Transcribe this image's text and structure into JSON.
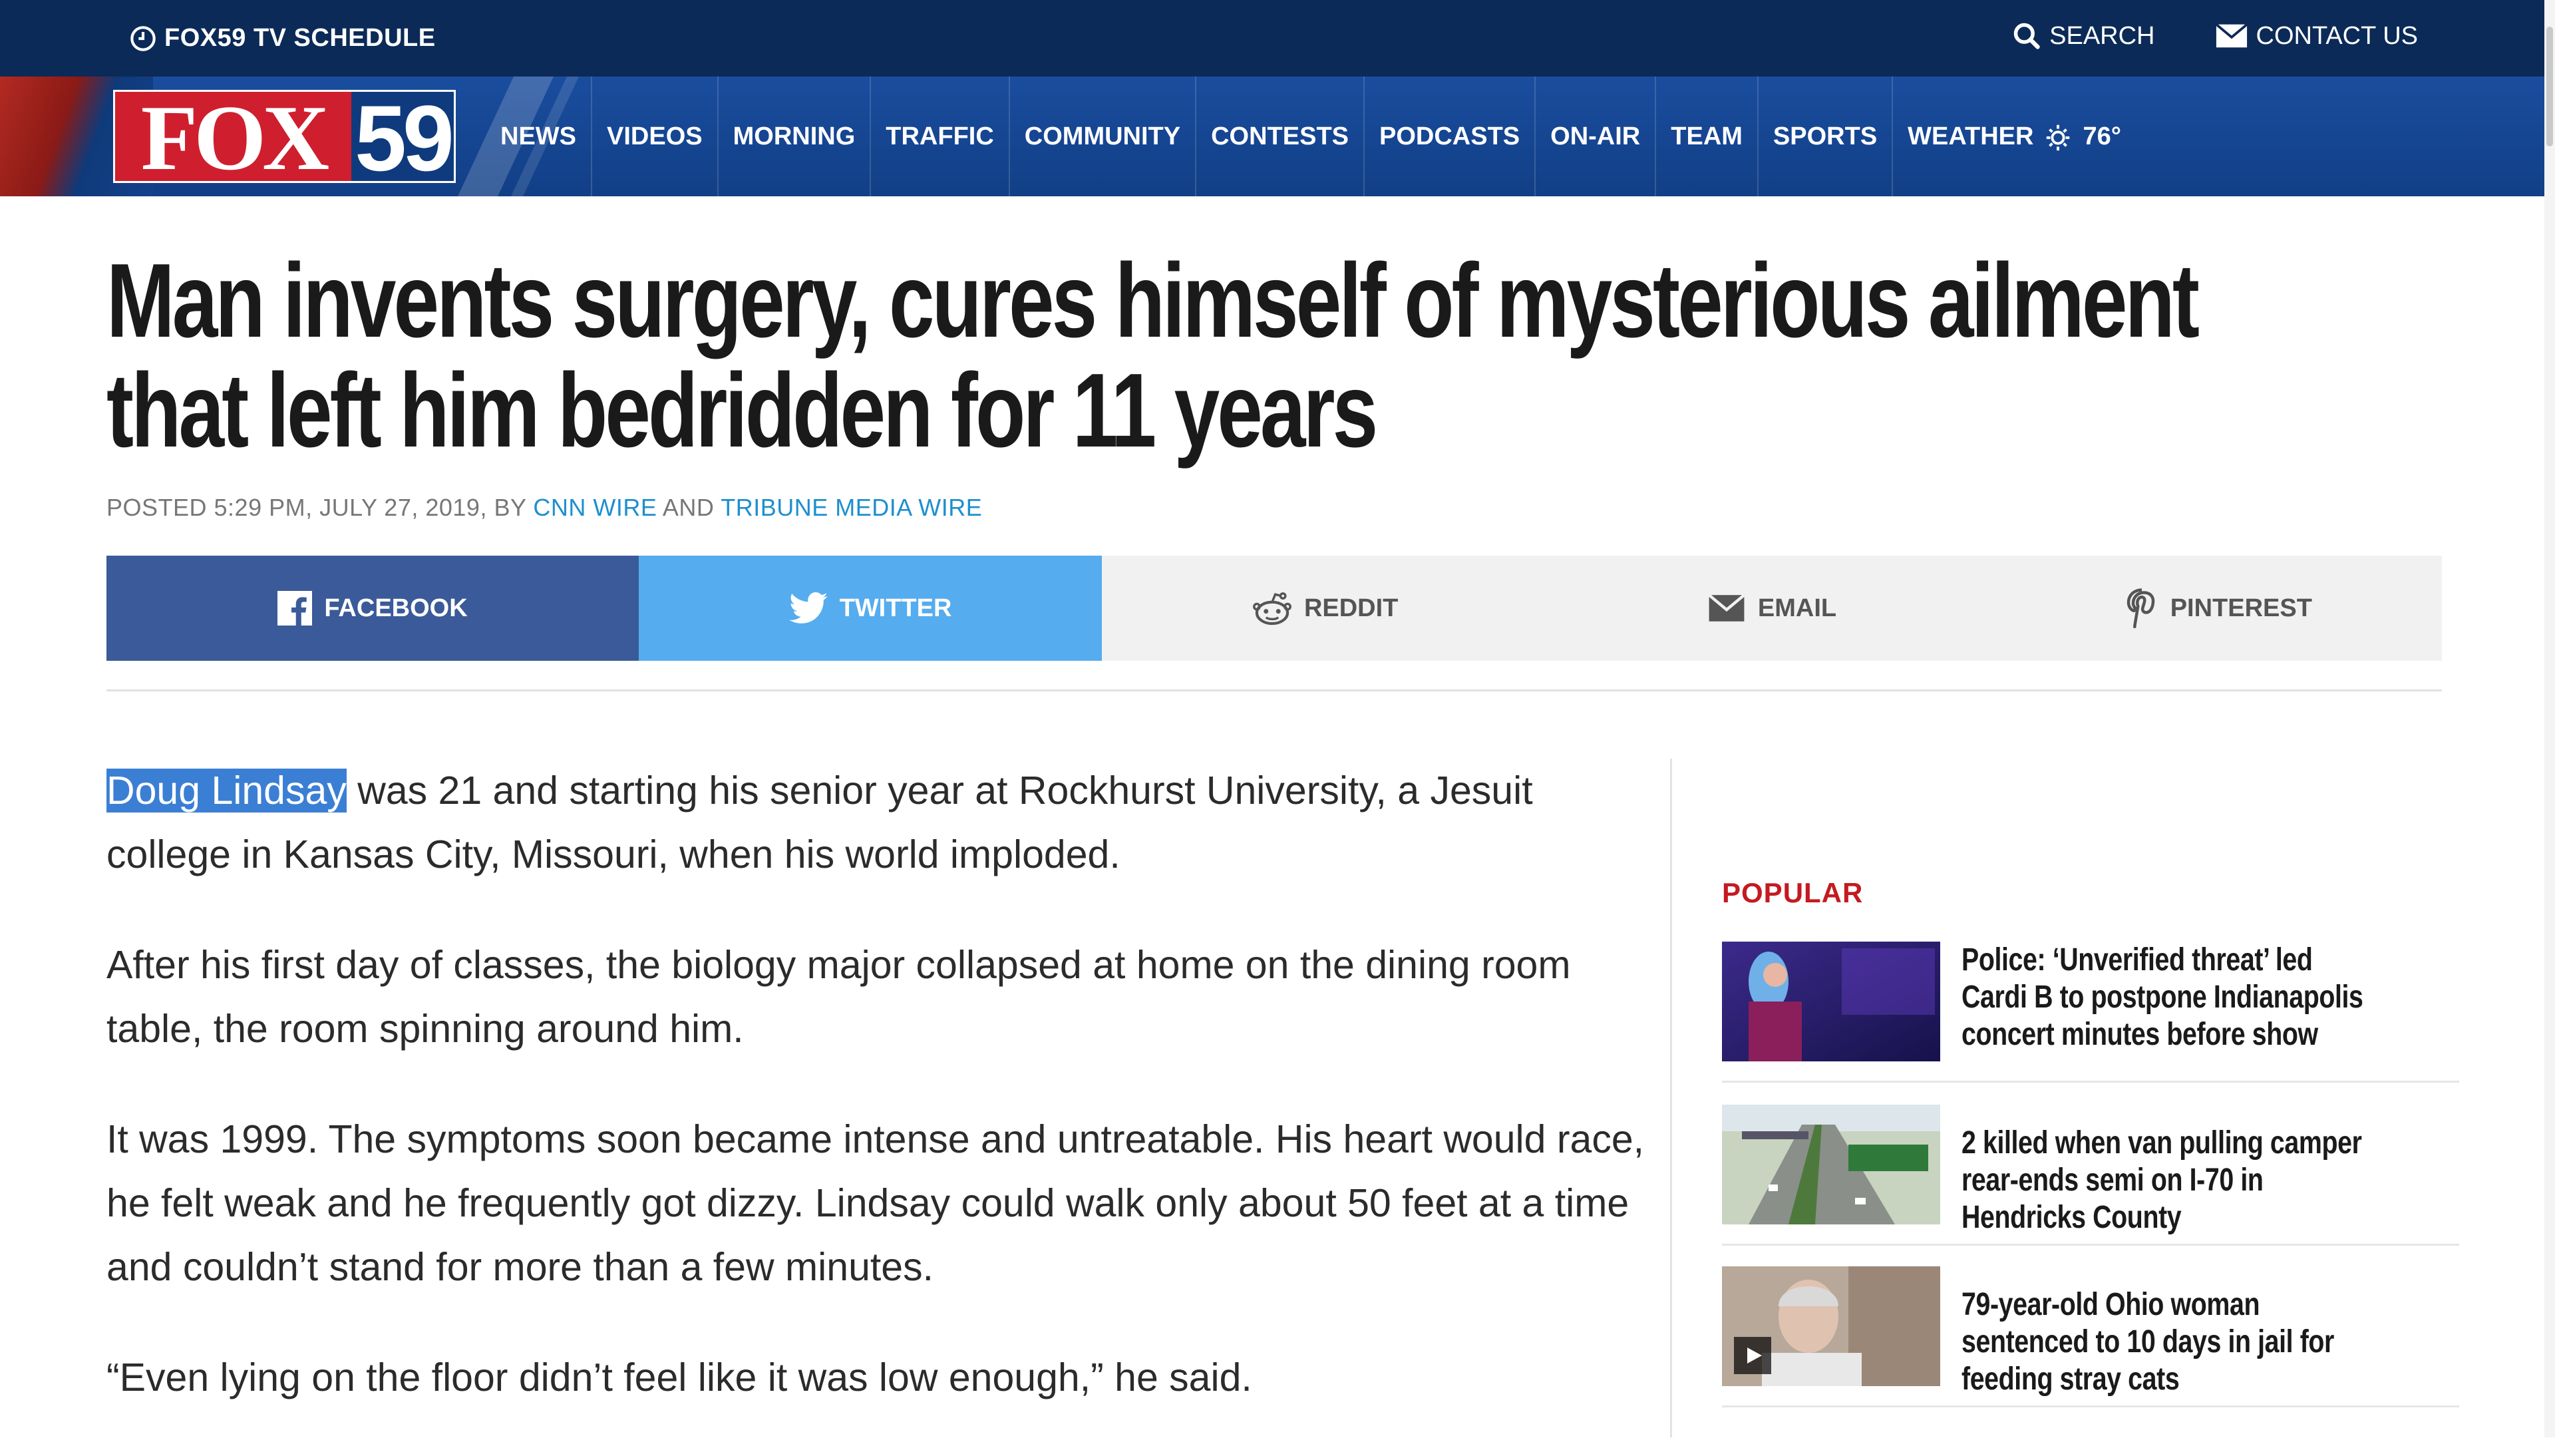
{
  "topbar": {
    "schedule": "FOX59 TV SCHEDULE",
    "search": "SEARCH",
    "contact": "CONTACT US"
  },
  "logo": {
    "fox": "FOX",
    "num": "59"
  },
  "nav": {
    "items": [
      "NEWS",
      "VIDEOS",
      "MORNING",
      "TRAFFIC",
      "COMMUNITY",
      "CONTESTS",
      "PODCASTS",
      "ON-AIR",
      "TEAM",
      "SPORTS"
    ],
    "weather": "WEATHER",
    "temp": "76°"
  },
  "article": {
    "headline": "Man invents surgery, cures himself of mysterious ailment that left him bedridden for 11 years",
    "byline_prefix": "POSTED 5:29 PM, JULY 27, 2019, BY",
    "author1": "CNN WIRE",
    "byline_and": "AND",
    "author2": "TRIBUNE MEDIA WIRE",
    "highlight": "Doug Lindsay",
    "p1_rest": " was 21 and starting his senior year at Rockhurst University, a Jesuit college in Kansas City, Missouri, when his world imploded.",
    "p2": "After his first day of classes, the biology major collapsed at home on the dining room table, the room spinning around him.",
    "p3": "It was 1999. The symptoms soon became intense and untreatable. His heart would race, he felt weak and he frequently got dizzy. Lindsay could walk only about 50 feet at a time and couldn’t stand for more than a few minutes.",
    "p4": "“Even lying on the floor didn’t feel like it was low enough,” he said."
  },
  "share": {
    "facebook": "FACEBOOK",
    "twitter": "TWITTER",
    "reddit": "REDDIT",
    "email": "EMAIL",
    "pinterest": "PINTEREST",
    "colors": {
      "facebook": "#3b5a99",
      "twitter": "#55acee"
    }
  },
  "sidebar": {
    "heading": "POPULAR",
    "items": [
      {
        "title": "Police: ‘Unverified threat’ led Cardi B to postpone Indianapolis concert minutes before show"
      },
      {
        "title": "2 killed when van pulling camper rear-ends semi on I-70 in Hendricks County"
      },
      {
        "title": "79-year-old Ohio woman sentenced to 10 days in jail for feeding stray cats"
      }
    ]
  },
  "colors": {
    "topbar": "#0b2a57",
    "nav": "#1a4d9e",
    "accent_red": "#c41a20",
    "link_blue": "#1d8fcf"
  }
}
